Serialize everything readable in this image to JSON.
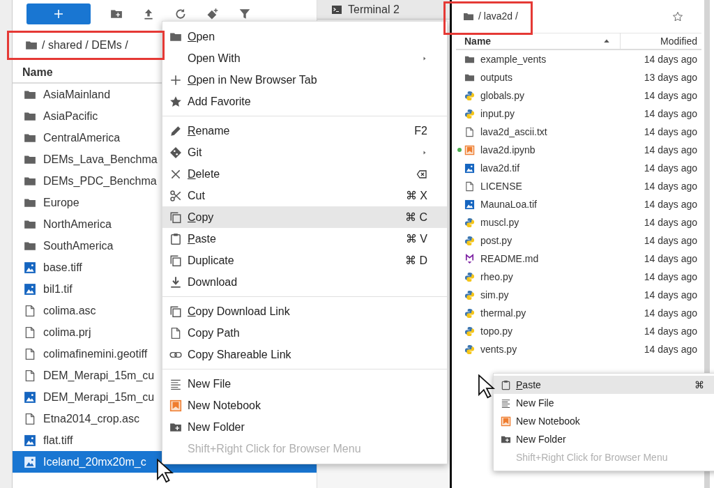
{
  "left_browser": {
    "breadcrumb": {
      "path": "/ shared / DEMs /",
      "highlighted": true
    },
    "header": {
      "name": "Name"
    },
    "files": [
      {
        "kind": "folder",
        "name": "AsiaMainland",
        "selected": false
      },
      {
        "kind": "folder",
        "name": "AsiaPacific",
        "selected": false
      },
      {
        "kind": "folder",
        "name": "CentralAmerica",
        "selected": false
      },
      {
        "kind": "folder",
        "name": "DEMs_Lava_Benchma",
        "selected": false
      },
      {
        "kind": "folder",
        "name": "DEMs_PDC_Benchma",
        "selected": false
      },
      {
        "kind": "folder",
        "name": "Europe",
        "selected": false
      },
      {
        "kind": "folder",
        "name": "NorthAmerica",
        "selected": false
      },
      {
        "kind": "folder",
        "name": "SouthAmerica",
        "selected": false
      },
      {
        "kind": "image",
        "name": "base.tiff",
        "selected": false
      },
      {
        "kind": "image",
        "name": "bil1.tif",
        "selected": false
      },
      {
        "kind": "text",
        "name": "colima.asc",
        "selected": false
      },
      {
        "kind": "text",
        "name": "colima.prj",
        "selected": false
      },
      {
        "kind": "text",
        "name": "colimafinemini.geotiff",
        "selected": false
      },
      {
        "kind": "text",
        "name": "DEM_Merapi_15m_cu",
        "selected": false
      },
      {
        "kind": "image",
        "name": "DEM_Merapi_15m_cu",
        "selected": false
      },
      {
        "kind": "text",
        "name": "Etna2014_crop.asc",
        "selected": false
      },
      {
        "kind": "image",
        "name": "flat.tiff",
        "selected": false
      },
      {
        "kind": "image",
        "name": "Iceland_20mx20m_c",
        "selected": true
      }
    ]
  },
  "terminal_tab": {
    "label": "Terminal 2"
  },
  "right_browser": {
    "breadcrumb": {
      "path": "/ lava2d /",
      "highlighted": true
    },
    "header": {
      "name": "Name",
      "modified": "Modified"
    },
    "files": [
      {
        "kind": "folder",
        "name": "example_vents",
        "modified": "14 days ago",
        "running": false
      },
      {
        "kind": "folder",
        "name": "outputs",
        "modified": "13 days ago",
        "running": false
      },
      {
        "kind": "python",
        "name": "globals.py",
        "modified": "14 days ago",
        "running": false
      },
      {
        "kind": "python",
        "name": "input.py",
        "modified": "14 days ago",
        "running": false
      },
      {
        "kind": "text",
        "name": "lava2d_ascii.txt",
        "modified": "14 days ago",
        "running": false
      },
      {
        "kind": "notebook",
        "name": "lava2d.ipynb",
        "modified": "14 days ago",
        "running": true
      },
      {
        "kind": "image",
        "name": "lava2d.tif",
        "modified": "14 days ago",
        "running": false
      },
      {
        "kind": "text",
        "name": "LICENSE",
        "modified": "14 days ago",
        "running": false
      },
      {
        "kind": "image",
        "name": "MaunaLoa.tif",
        "modified": "14 days ago",
        "running": false
      },
      {
        "kind": "python",
        "name": "muscl.py",
        "modified": "14 days ago",
        "running": false
      },
      {
        "kind": "python",
        "name": "post.py",
        "modified": "14 days ago",
        "running": false
      },
      {
        "kind": "markdown",
        "name": "README.md",
        "modified": "14 days ago",
        "running": false
      },
      {
        "kind": "python",
        "name": "rheo.py",
        "modified": "14 days ago",
        "running": false
      },
      {
        "kind": "python",
        "name": "sim.py",
        "modified": "14 days ago",
        "running": false
      },
      {
        "kind": "python",
        "name": "thermal.py",
        "modified": "14 days ago",
        "running": false
      },
      {
        "kind": "python",
        "name": "topo.py",
        "modified": "14 days ago",
        "running": false
      },
      {
        "kind": "python",
        "name": "vents.py",
        "modified": "14 days ago",
        "running": false
      }
    ]
  },
  "file_menu": {
    "groups": [
      [
        {
          "kind": "folder",
          "label": "Open",
          "mnemonic": true,
          "selected": false
        },
        {
          "kind": "none",
          "label": "Open With",
          "mnemonic": false,
          "submenu": true,
          "selected": false
        },
        {
          "kind": "plus",
          "label": "Open in New Browser Tab",
          "mnemonic": true,
          "selected": false
        },
        {
          "kind": "star",
          "label": "Add Favorite",
          "mnemonic": false,
          "selected": false
        }
      ],
      [
        {
          "kind": "pencil",
          "label": "Rename",
          "mnemonic": true,
          "shortcut": "F2",
          "selected": false
        },
        {
          "kind": "git",
          "label": "Git",
          "mnemonic": false,
          "submenu": true,
          "selected": false
        },
        {
          "kind": "close",
          "label": "Delete",
          "mnemonic": true,
          "backspace_shortcut": true,
          "selected": false
        },
        {
          "kind": "scissors",
          "label": "Cut",
          "mnemonic": false,
          "shortcut": "⌘ X",
          "selected": false
        },
        {
          "kind": "copy",
          "label": "Copy",
          "mnemonic": true,
          "shortcut": "⌘ C",
          "selected": true
        },
        {
          "kind": "clipboard",
          "label": "Paste",
          "mnemonic": true,
          "shortcut": "⌘ V",
          "selected": false
        },
        {
          "kind": "copy",
          "label": "Duplicate",
          "mnemonic": false,
          "shortcut": "⌘ D",
          "selected": false
        },
        {
          "kind": "download",
          "label": "Download",
          "mnemonic": false,
          "selected": false
        }
      ],
      [
        {
          "kind": "copy",
          "label": "Copy Download Link",
          "mnemonic": true,
          "selected": false
        },
        {
          "kind": "file",
          "label": "Copy Path",
          "mnemonic": false,
          "selected": false
        },
        {
          "kind": "link",
          "label": "Copy Shareable Link",
          "mnemonic": false,
          "selected": false
        }
      ],
      [
        {
          "kind": "lines",
          "label": "New File",
          "mnemonic": false,
          "selected": false
        },
        {
          "kind": "notebook",
          "label": "New Notebook",
          "mnemonic": false,
          "selected": false
        },
        {
          "kind": "newfolder",
          "label": "New Folder",
          "mnemonic": false,
          "selected": false
        },
        {
          "kind": "none",
          "label": "Shift+Right Click for Browser Menu",
          "mnemonic": false,
          "disabled": true,
          "selected": false
        }
      ]
    ]
  },
  "folder_menu": {
    "groups": [
      [
        {
          "kind": "clipboard",
          "label": "Paste",
          "mnemonic": true,
          "shortcut": "⌘",
          "selected": true
        },
        {
          "kind": "lines",
          "label": "New File",
          "mnemonic": false,
          "selected": false
        },
        {
          "kind": "notebook",
          "label": "New Notebook",
          "mnemonic": false,
          "selected": false
        },
        {
          "kind": "newfolder",
          "label": "New Folder",
          "mnemonic": false,
          "selected": false
        },
        {
          "kind": "none",
          "label": "Shift+Right Click for Browser Menu",
          "mnemonic": false,
          "disabled": true,
          "selected": false
        }
      ]
    ]
  }
}
